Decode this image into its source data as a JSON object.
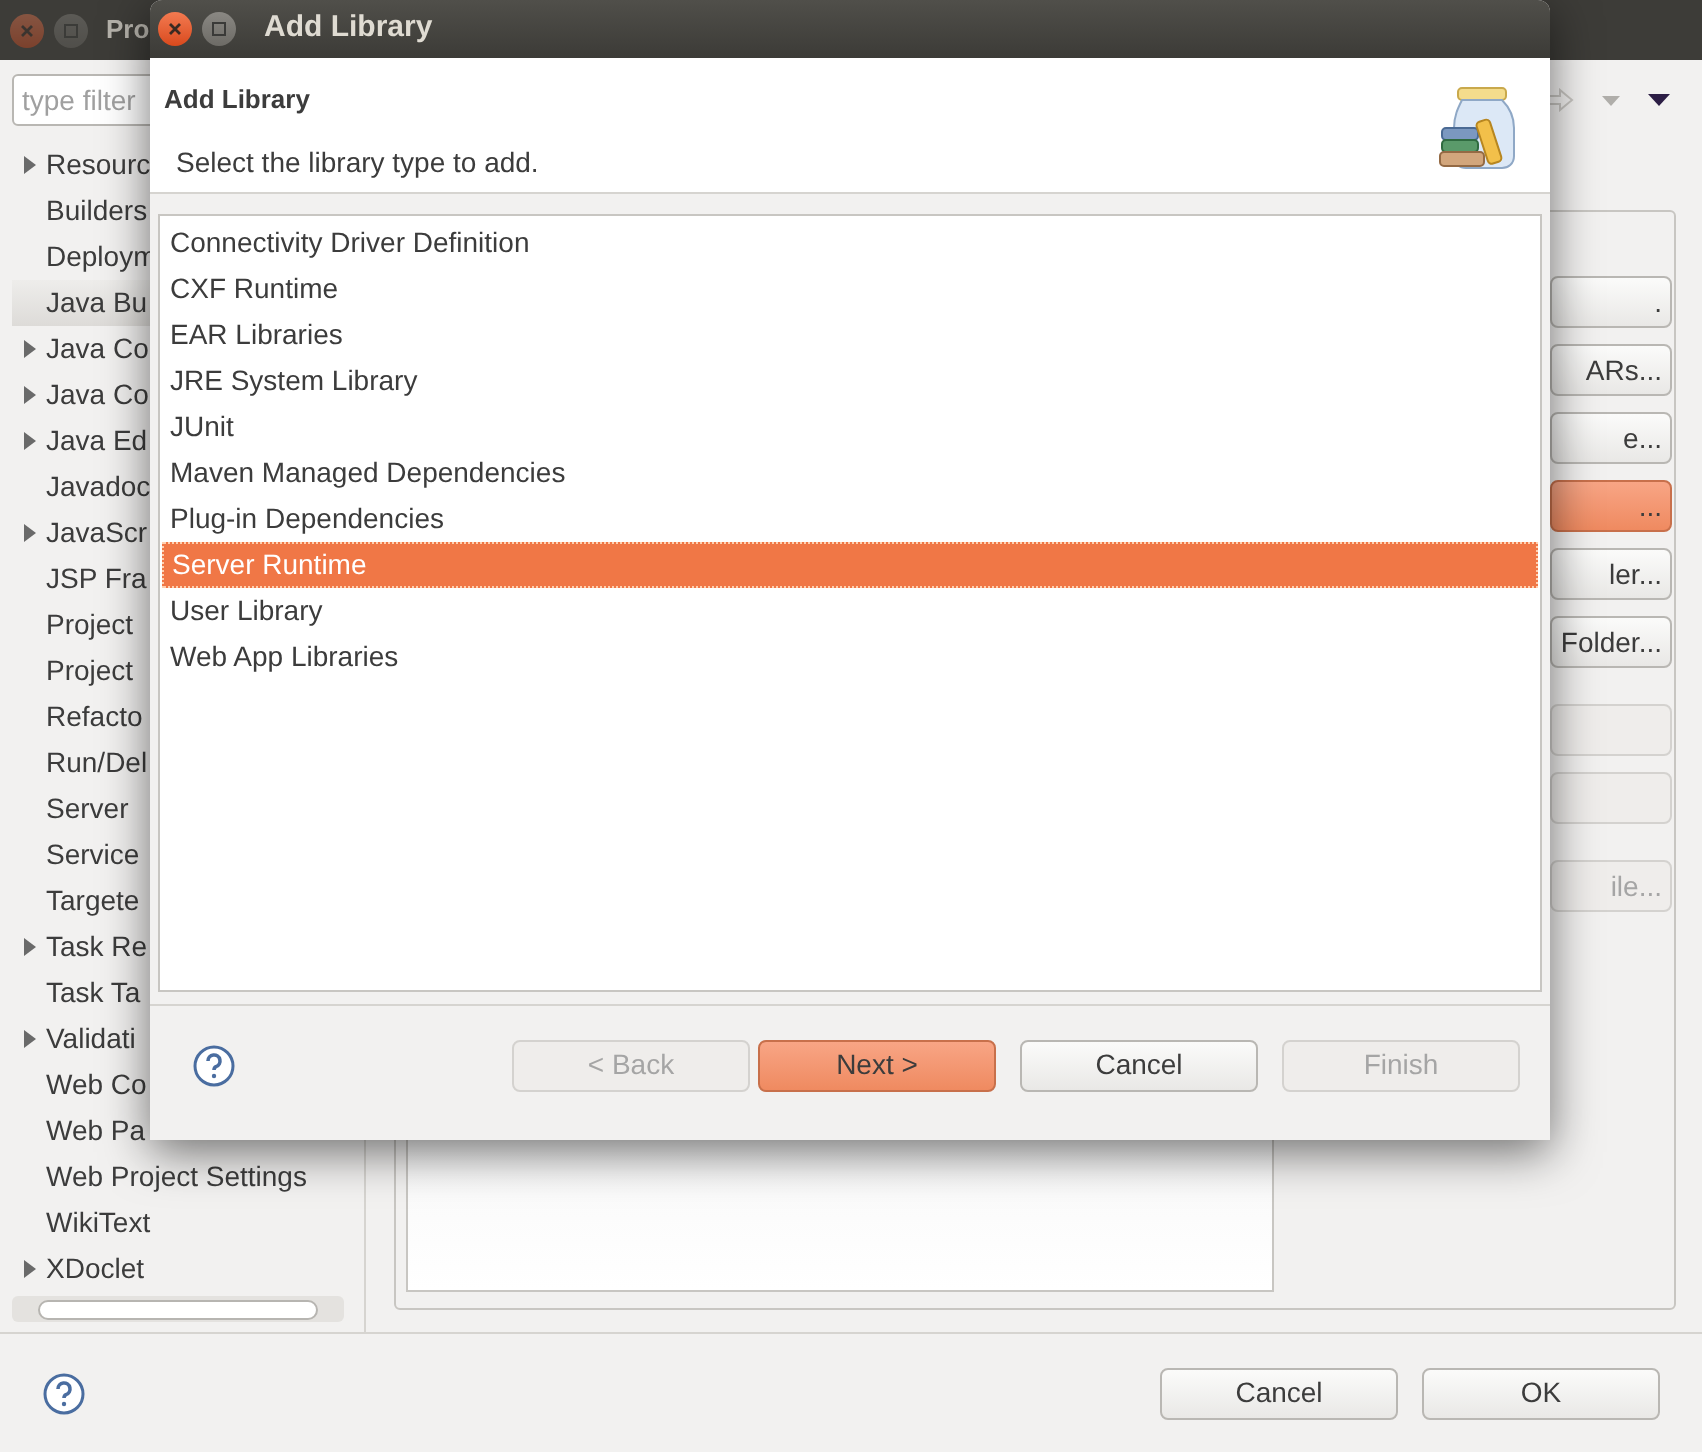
{
  "background_window": {
    "title": "Pro",
    "filter": {
      "placeholder": "type filter"
    },
    "tree": [
      {
        "label": "Resourc",
        "expandable": true,
        "selected": false
      },
      {
        "label": "Builders",
        "expandable": false,
        "selected": false
      },
      {
        "label": "Deploym",
        "expandable": false,
        "selected": false
      },
      {
        "label": "Java Bu",
        "expandable": false,
        "selected": true
      },
      {
        "label": "Java Co",
        "expandable": true,
        "selected": false
      },
      {
        "label": "Java Co",
        "expandable": true,
        "selected": false
      },
      {
        "label": "Java Ed",
        "expandable": true,
        "selected": false
      },
      {
        "label": "Javadoc",
        "expandable": false,
        "selected": false
      },
      {
        "label": "JavaScr",
        "expandable": true,
        "selected": false
      },
      {
        "label": "JSP Fra",
        "expandable": false,
        "selected": false
      },
      {
        "label": "Project",
        "expandable": false,
        "selected": false
      },
      {
        "label": "Project",
        "expandable": false,
        "selected": false
      },
      {
        "label": "Refacto",
        "expandable": false,
        "selected": false
      },
      {
        "label": "Run/Del",
        "expandable": false,
        "selected": false
      },
      {
        "label": "Server",
        "expandable": false,
        "selected": false
      },
      {
        "label": "Service",
        "expandable": false,
        "selected": false
      },
      {
        "label": "Targete",
        "expandable": false,
        "selected": false
      },
      {
        "label": "Task Re",
        "expandable": true,
        "selected": false
      },
      {
        "label": "Task Ta",
        "expandable": false,
        "selected": false
      },
      {
        "label": "Validati",
        "expandable": true,
        "selected": false
      },
      {
        "label": "Web Co",
        "expandable": false,
        "selected": false
      },
      {
        "label": "Web Pa",
        "expandable": false,
        "selected": false
      },
      {
        "label": "Web Project Settings",
        "expandable": false,
        "selected": false
      },
      {
        "label": "WikiText",
        "expandable": false,
        "selected": false
      },
      {
        "label": "XDoclet",
        "expandable": true,
        "selected": false
      }
    ],
    "side_buttons": [
      {
        "label": ".",
        "disabled": false,
        "default": false
      },
      {
        "label": "ARs...",
        "disabled": false,
        "default": false
      },
      {
        "label": "e...",
        "disabled": false,
        "default": false
      },
      {
        "label": "...",
        "disabled": false,
        "default": true
      },
      {
        "label": "ler...",
        "disabled": false,
        "default": false
      },
      {
        "label": "Folder...",
        "disabled": false,
        "default": false
      },
      {
        "disabled": true
      },
      {
        "disabled": true
      },
      {
        "label": "ile...",
        "disabled": true
      }
    ],
    "buttons": [
      {
        "label": "Cancel"
      },
      {
        "label": "OK"
      }
    ]
  },
  "dialog": {
    "title": "Add Library",
    "header": {
      "title": "Add Library",
      "message": "Select the library type to add."
    },
    "library_types": [
      {
        "label": "Connectivity Driver Definition",
        "selected": false
      },
      {
        "label": "CXF Runtime",
        "selected": false
      },
      {
        "label": "EAR Libraries",
        "selected": false
      },
      {
        "label": "JRE System Library",
        "selected": false
      },
      {
        "label": "JUnit",
        "selected": false
      },
      {
        "label": "Maven Managed Dependencies",
        "selected": false
      },
      {
        "label": "Plug-in Dependencies",
        "selected": false
      },
      {
        "label": "Server Runtime",
        "selected": true
      },
      {
        "label": "User Library",
        "selected": false
      },
      {
        "label": "Web App Libraries",
        "selected": false
      }
    ],
    "buttons": [
      {
        "label": "< Back",
        "disabled": true
      },
      {
        "label": "Next >",
        "disabled": false,
        "default": true
      },
      {
        "label": "Cancel",
        "disabled": false,
        "default": false
      },
      {
        "label": "Finish",
        "disabled": true
      }
    ]
  }
}
